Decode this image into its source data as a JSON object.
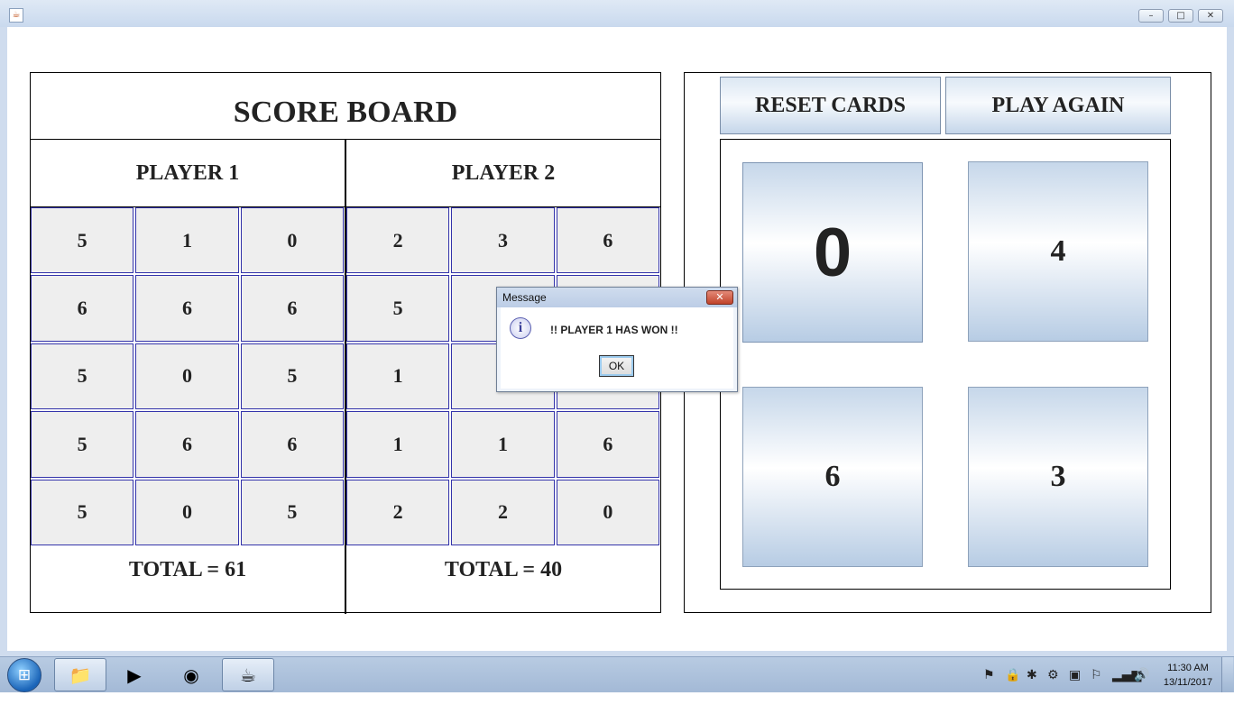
{
  "window": {
    "app_icon": "java-coffee-icon",
    "controls": [
      "minimize",
      "maximize",
      "close"
    ]
  },
  "scoreboard": {
    "title": "SCORE BOARD",
    "players": [
      {
        "name": "PLAYER 1",
        "cells": [
          "5",
          "1",
          "0",
          "6",
          "6",
          "6",
          "5",
          "0",
          "5",
          "5",
          "6",
          "6",
          "5",
          "0",
          "5"
        ],
        "total": "TOTAL = 61"
      },
      {
        "name": "PLAYER 2",
        "cells": [
          "2",
          "3",
          "6",
          "5",
          "",
          "",
          "1",
          "",
          "",
          "1",
          "1",
          "6",
          "2",
          "2",
          "0"
        ],
        "total": "TOTAL = 40"
      }
    ]
  },
  "controls": {
    "reset_label": "RESET CARDS",
    "play_again_label": "PLAY AGAIN"
  },
  "cards": [
    "0",
    "4",
    "6",
    "3"
  ],
  "dialog": {
    "title": "Message",
    "message": "!! PLAYER 1 HAS WON !!",
    "ok_label": "OK",
    "icon": "info-icon"
  },
  "taskbar": {
    "items": [
      "start-orb",
      "file-explorer",
      "media-player",
      "chrome",
      "java-app"
    ],
    "active_item": "java-app",
    "clock_time": "11:30 AM",
    "clock_date": "13/11/2017"
  }
}
